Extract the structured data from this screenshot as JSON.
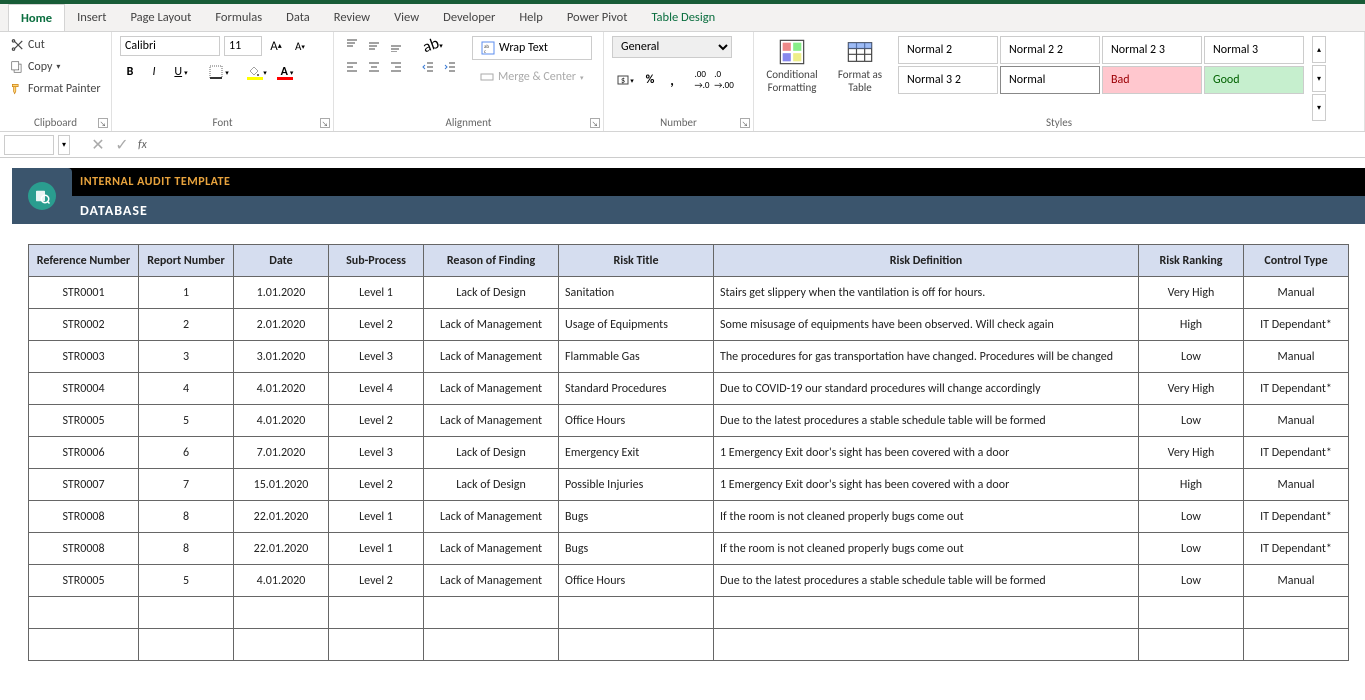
{
  "tabs": {
    "home": "Home",
    "insert": "Insert",
    "pageLayout": "Page Layout",
    "formulas": "Formulas",
    "data": "Data",
    "review": "Review",
    "view": "View",
    "developer": "Developer",
    "help": "Help",
    "powerPivot": "Power Pivot",
    "tableDesign": "Table Design"
  },
  "clipboard": {
    "cut": "Cut",
    "copy": "Copy",
    "formatPainter": "Format Painter",
    "label": "Clipboard"
  },
  "font": {
    "name": "Calibri",
    "size": "11",
    "label": "Font"
  },
  "alignment": {
    "wrapText": "Wrap Text",
    "mergeCenter": "Merge & Center",
    "label": "Alignment"
  },
  "number": {
    "format": "General",
    "label": "Number"
  },
  "styles": {
    "conditional": "Conditional Formatting",
    "formatTable": "Format as Table",
    "label": "Styles",
    "cells": {
      "normal2": "Normal 2",
      "normal22": "Normal 2 2",
      "normal23": "Normal 2 3",
      "normal3": "Normal 3",
      "normal32": "Normal 3 2",
      "normal": "Normal",
      "bad": "Bad",
      "good": "Good"
    }
  },
  "sheet": {
    "title": "INTERNAL AUDIT TEMPLATE",
    "subtitle": "DATABASE"
  },
  "table": {
    "headers": {
      "ref": "Reference Number",
      "rep": "Report Number",
      "date": "Date",
      "sub": "Sub-Process",
      "reason": "Reason of Finding",
      "riskTitle": "Risk Title",
      "riskDef": "Risk Definition",
      "rank": "Risk Ranking",
      "ctrl": "Control Type"
    },
    "rows": [
      {
        "ref": "STR0001",
        "rep": "1",
        "date": "1.01.2020",
        "sub": "Level 1",
        "reason": "Lack of Design",
        "riskTitle": "Sanitation",
        "riskDef": "Stairs get slippery when the vantilation is off for hours.",
        "rank": "Very High",
        "ctrl": "Manual"
      },
      {
        "ref": "STR0002",
        "rep": "2",
        "date": "2.01.2020",
        "sub": "Level 2",
        "reason": "Lack of Management",
        "riskTitle": "Usage of Equipments",
        "riskDef": "Some misusage of equipments have been observed. Will check again",
        "rank": "High",
        "ctrl": "IT Dependant*"
      },
      {
        "ref": "STR0003",
        "rep": "3",
        "date": "3.01.2020",
        "sub": "Level 3",
        "reason": "Lack of Management",
        "riskTitle": "Flammable Gas",
        "riskDef": "The procedures for gas transportation have changed. Procedures will be changed",
        "rank": "Low",
        "ctrl": "Manual"
      },
      {
        "ref": "STR0004",
        "rep": "4",
        "date": "4.01.2020",
        "sub": "Level 4",
        "reason": "Lack of Management",
        "riskTitle": "Standard Procedures",
        "riskDef": "Due to COVID-19 our standard procedures will change accordingly",
        "rank": "Very High",
        "ctrl": "IT Dependant*"
      },
      {
        "ref": "STR0005",
        "rep": "5",
        "date": "4.01.2020",
        "sub": "Level 2",
        "reason": "Lack of Management",
        "riskTitle": "Office Hours",
        "riskDef": "Due to the latest procedures a stable schedule table will be formed",
        "rank": "Low",
        "ctrl": "Manual"
      },
      {
        "ref": "STR0006",
        "rep": "6",
        "date": "7.01.2020",
        "sub": "Level 3",
        "reason": "Lack of Design",
        "riskTitle": "Emergency Exit",
        "riskDef": "1 Emergency Exit door's sight has been covered with a door",
        "rank": "Very High",
        "ctrl": "IT Dependant*"
      },
      {
        "ref": "STR0007",
        "rep": "7",
        "date": "15.01.2020",
        "sub": "Level 2",
        "reason": "Lack of Design",
        "riskTitle": "Possible Injuries",
        "riskDef": "1 Emergency Exit door's sight has been covered with a door",
        "rank": "High",
        "ctrl": "Manual"
      },
      {
        "ref": "STR0008",
        "rep": "8",
        "date": "22.01.2020",
        "sub": "Level 1",
        "reason": "Lack of Management",
        "riskTitle": "Bugs",
        "riskDef": "If the room is not cleaned properly bugs come out",
        "rank": "Low",
        "ctrl": "IT Dependant*"
      },
      {
        "ref": "STR0008",
        "rep": "8",
        "date": "22.01.2020",
        "sub": "Level 1",
        "reason": "Lack of Management",
        "riskTitle": "Bugs",
        "riskDef": "If the room is not cleaned properly bugs come out",
        "rank": "Low",
        "ctrl": "IT Dependant*"
      },
      {
        "ref": "STR0005",
        "rep": "5",
        "date": "4.01.2020",
        "sub": "Level 2",
        "reason": "Lack of Management",
        "riskTitle": "Office Hours",
        "riskDef": "Due to the latest procedures a stable schedule table will be formed",
        "rank": "Low",
        "ctrl": "Manual"
      },
      {
        "ref": "",
        "rep": "",
        "date": "",
        "sub": "",
        "reason": "",
        "riskTitle": "",
        "riskDef": "",
        "rank": "",
        "ctrl": ""
      },
      {
        "ref": "",
        "rep": "",
        "date": "",
        "sub": "",
        "reason": "",
        "riskTitle": "",
        "riskDef": "",
        "rank": "",
        "ctrl": ""
      }
    ]
  }
}
